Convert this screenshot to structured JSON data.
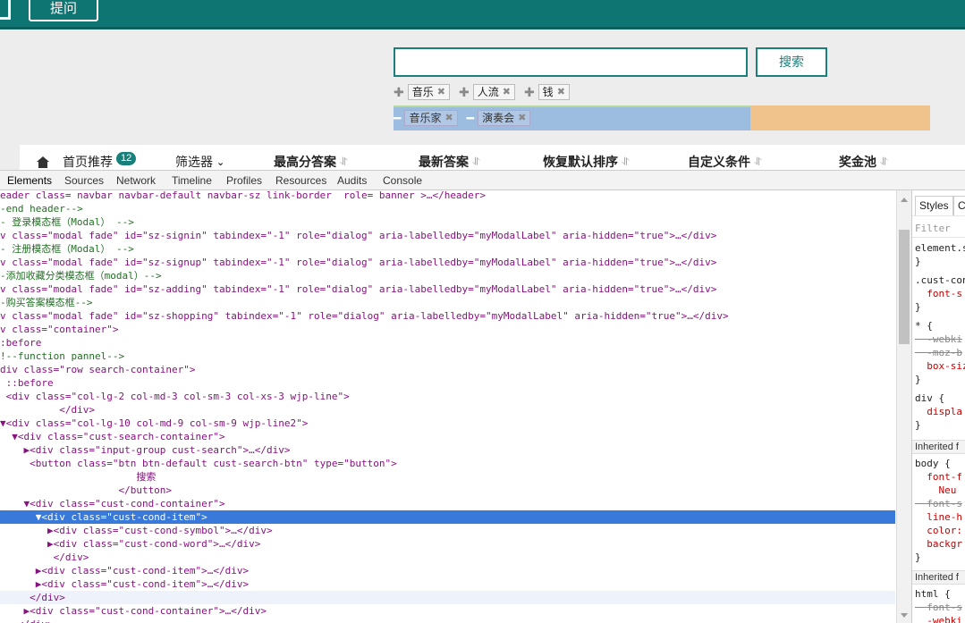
{
  "page": {
    "ask_button": "提问",
    "search_button": "搜索",
    "tags": [
      "音乐",
      "人流",
      "钱"
    ],
    "cond_tags": [
      "音乐家",
      "演奏会"
    ],
    "nav": {
      "home": "首页推荐",
      "home_badge": "12",
      "filter": "筛选器",
      "items": [
        "最高分答案",
        "最新答案",
        "恢复默认排序",
        "自定义条件",
        "奖金池"
      ]
    }
  },
  "devtools": {
    "tabs": [
      "Elements",
      "Sources",
      "Network",
      "Timeline",
      "Profiles",
      "Resources",
      "Audits",
      "Console"
    ],
    "lines": [
      "eader class= navbar navbar-default navbar-sz link-border  role= banner >…</header>",
      "-end header-->",
      "- 登录模态框（Modal） -->",
      "v class=\"modal fade\" id=\"sz-signin\" tabindex=\"-1\" role=\"dialog\" aria-labelledby=\"myModalLabel\" aria-hidden=\"true\">…</div>",
      "- 注册模态框（Modal） -->",
      "v class=\"modal fade\" id=\"sz-signup\" tabindex=\"-1\" role=\"dialog\" aria-labelledby=\"myModalLabel\" aria-hidden=\"true\">…</div>",
      "-添加收藏分类模态框（modal）-->",
      "v class=\"modal fade\" id=\"sz-adding\" tabindex=\"-1\" role=\"dialog\" aria-labelledby=\"myModalLabel\" aria-hidden=\"true\">…</div>",
      "-购买答案模态框-->",
      "v class=\"modal fade\" id=\"sz-shopping\" tabindex=\"-1\" role=\"dialog\" aria-labelledby=\"myModalLabel\" aria-hidden=\"true\">…</div>",
      "v class=\"container\">",
      ":before",
      "!--function pannel-->",
      "div class=\"row search-container\">",
      " ::before",
      " <div class=\"col-lg-2 col-md-3 col-sm-3 col-xs-3 wjp-line\">",
      "          </div>",
      "▼<div class=\"col-lg-10 col-md-9 col-sm-9 wjp-line2\">",
      "  ▼<div class=\"cust-search-container\">",
      "    ▶<div class=\"input-group cust-search\">…</div>",
      "     <button class=\"btn btn-default cust-search-btn\" type=\"button\">",
      "                       搜索",
      "                    </button>",
      "    ▼<div class=\"cust-cond-container\">",
      "      ▼<div class=\"cust-cond-item\">",
      "        ▶<div class=\"cust-cond-symbol\">…</div>",
      "        ▶<div class=\"cust-cond-word\">…</div>",
      "         </div>",
      "      ▶<div class=\"cust-cond-item\">…</div>",
      "      ▶<div class=\"cust-cond-item\">…</div>",
      "     </div>",
      "    ▶<div class=\"cust-cond-container\">…</div>",
      "   </div>"
    ],
    "styles": {
      "tabs": [
        "Styles",
        "Co"
      ],
      "filter_placeholder": "Filter",
      "rules": [
        "element.s",
        "}",
        ".cust-con",
        "  font-s",
        "}",
        "* {",
        "  -webki",
        "  -moz-b",
        "  box-siz",
        "}",
        "div {",
        "  displa",
        "}"
      ],
      "inherited_1": "Inherited f",
      "body_rules": [
        "body {",
        "  font-f",
        "    Neu",
        "  font-s",
        "  line-h",
        "  color:",
        "  backgr",
        "}"
      ],
      "inherited_2": "Inherited f",
      "html_rules": [
        "html {",
        "  font-s",
        "  -webki",
        "}"
      ]
    }
  }
}
